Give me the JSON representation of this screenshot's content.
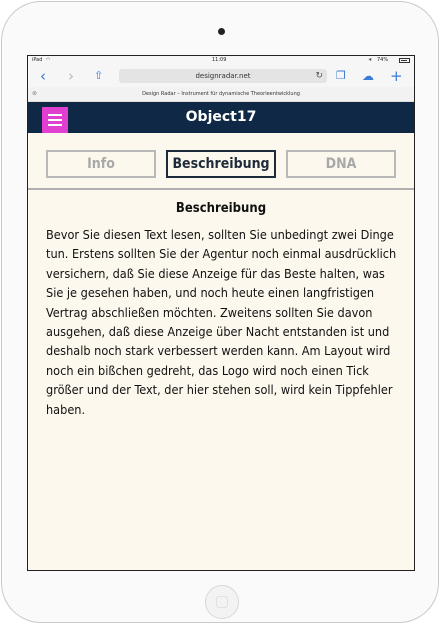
{
  "statusbar": {
    "device": "iPad",
    "wifi": "wifi-icon",
    "time": "11:09",
    "battery_pct": "74%"
  },
  "browser": {
    "url": "designradar.net",
    "back_icon": "chevron-left-icon",
    "forward_icon": "chevron-right-icon",
    "share_icon": "share-icon",
    "reload_icon": "reload-icon",
    "bookmarks_icon": "book-icon",
    "cloud_icon": "cloud-icon",
    "new_tab_icon": "plus-icon"
  },
  "page_title": "Design Radar – Instrument für dynamische Theorieentwicklung",
  "app": {
    "title": "Object17",
    "accent": "#e03fcf",
    "bar_color": "#0e2845"
  },
  "tabs": [
    {
      "label": "Info",
      "active": false
    },
    {
      "label": "Beschreibung",
      "active": true
    },
    {
      "label": "DNA",
      "active": false
    }
  ],
  "content": {
    "heading": "Beschreibung",
    "text": "Bevor Sie diesen Text lesen, sollten Sie unbedingt zwei Dinge tun. Erstens sollten Sie der Agentur noch einmal ausdrücklich versichern, daß Sie diese Anzeige für das Beste halten, was Sie je gesehen haben, und noch heute einen langfristigen Vertrag abschließen möchten. Zweitens sollten Sie davon ausgehen, daß diese Anzeige über Nacht entstanden ist und deshalb noch stark verbessert werden kann. Am Layout wird noch ein bißchen gedreht, das Logo wird noch einen Tick größer und der Text, der hier stehen soll, wird kein Tippfehler haben."
  }
}
